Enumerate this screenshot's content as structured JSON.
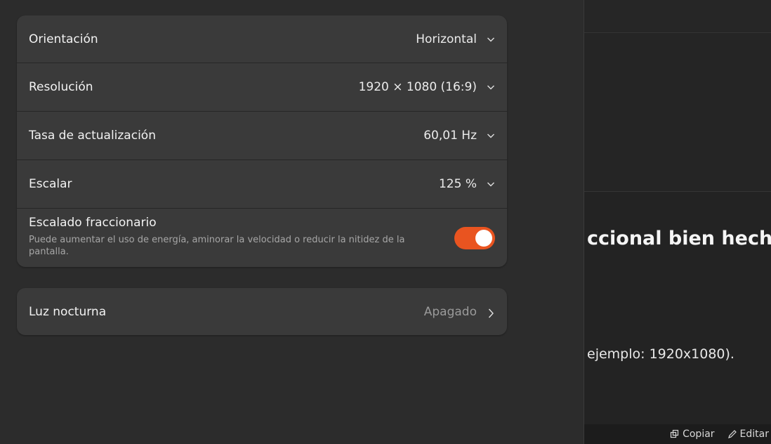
{
  "display": {
    "orientation": {
      "label": "Orientación",
      "value": "Horizontal"
    },
    "resolution": {
      "label": "Resolución",
      "value": "1920 × 1080 (16:9)"
    },
    "refresh_rate": {
      "label": "Tasa de actualización",
      "value": "60,01 Hz"
    },
    "scale": {
      "label": "Escalar",
      "value": "125 %"
    },
    "fractional_scaling": {
      "title": "Escalado fraccionario",
      "subtitle": "Puede aumentar el uso de energía, aminorar la velocidad o reducir la nitidez de la pantalla.",
      "enabled": true
    }
  },
  "night_light": {
    "label": "Luz nocturna",
    "value": "Apagado"
  },
  "background_window": {
    "heading": "ccional bien hecho)",
    "text": "ejemplo: 1920x1080).",
    "copy_label": "Copiar",
    "edit_label": "Editar"
  },
  "colors": {
    "accent": "#e95420"
  }
}
